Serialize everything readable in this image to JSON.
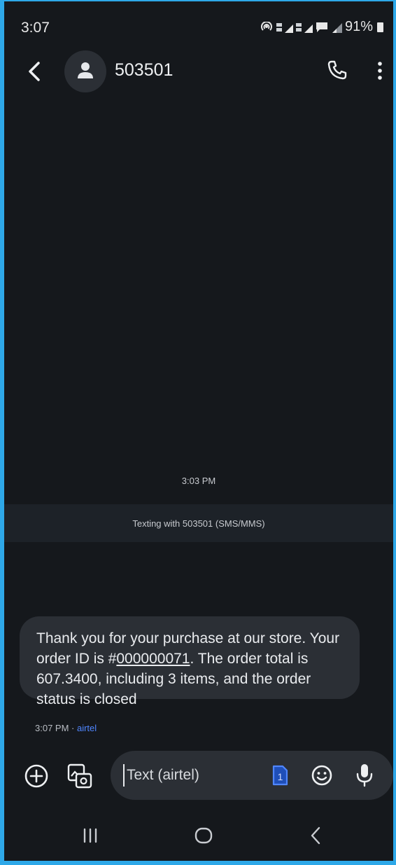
{
  "status_bar": {
    "time": "3:07",
    "battery": "91%",
    "icons": [
      "hotspot-icon",
      "volte-signal-icon",
      "volte-signal-icon",
      "message-icon",
      "signal-icon",
      "battery-icon"
    ]
  },
  "header": {
    "contact": "503501",
    "icons": {
      "back": "back-arrow-icon",
      "avatar": "person-icon",
      "call": "phone-icon",
      "more": "more-vertical-icon"
    }
  },
  "conversation": {
    "date_divider": "3:03 PM",
    "texting_banner": "Texting with 503501 (SMS/MMS)",
    "message": {
      "text_before": "Thank you for your purchase at our store. Your order ID is #",
      "order_id": "000000071",
      "text_after": ". The order total is 607.3400,  including 3 items, and the order status is closed",
      "time": "3:07 PM",
      "separator": " · ",
      "carrier": "airtel"
    }
  },
  "compose": {
    "placeholder": "Text (airtel)",
    "sim_number": "1",
    "icons": [
      "add-icon",
      "gallery-icon",
      "sim-icon",
      "emoji-icon",
      "mic-icon"
    ]
  },
  "nav_bar": {
    "icons": [
      "recents-icon",
      "home-icon",
      "back-icon"
    ]
  },
  "colors": {
    "background": "#15181c",
    "bubble": "#2b2f35",
    "banner": "#1d2228",
    "accent": "#4f86ff",
    "frame": "#2ea8e8"
  }
}
